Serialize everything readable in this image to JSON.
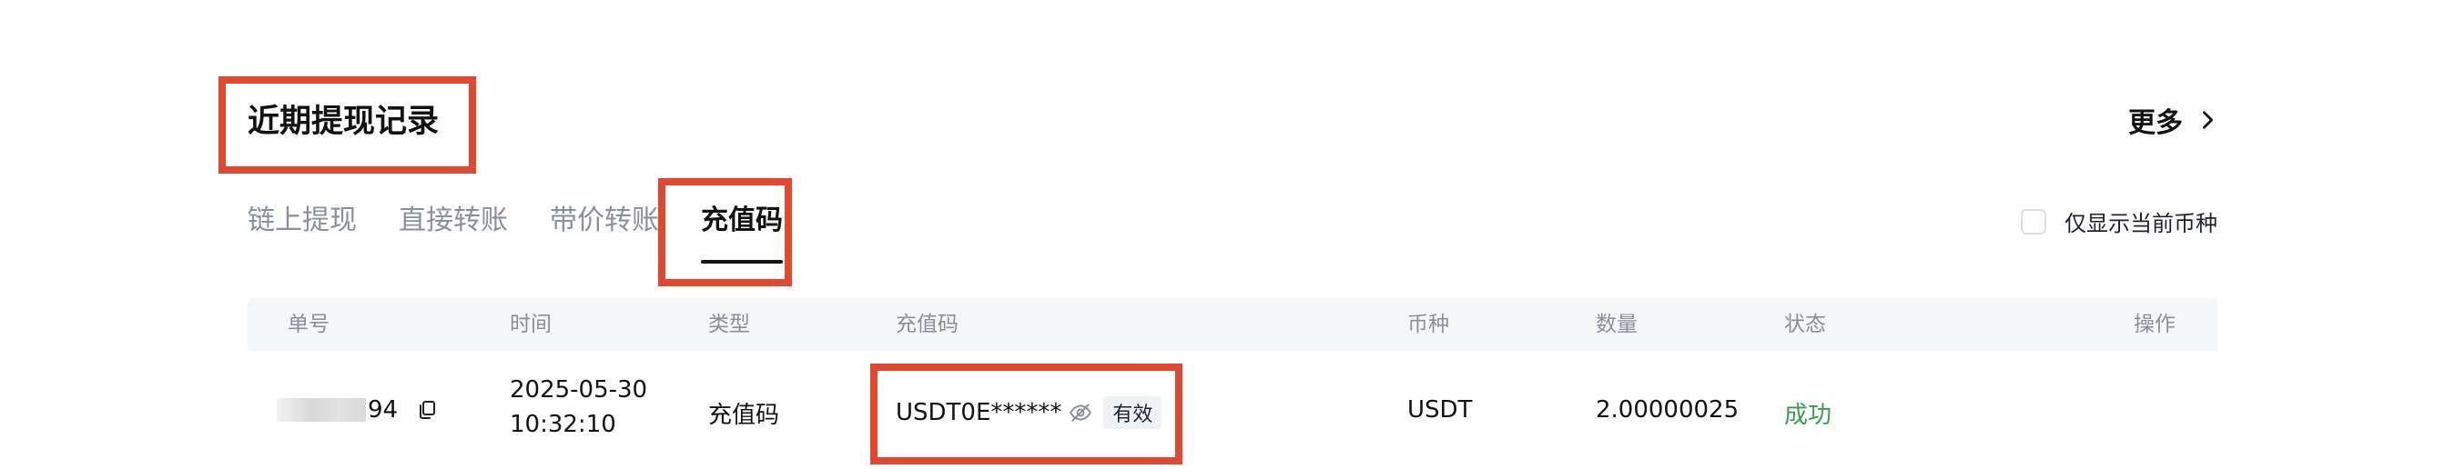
{
  "header": {
    "title": "近期提现记录",
    "more_label": "更多"
  },
  "tabs": [
    {
      "label": "链上提现",
      "active": false
    },
    {
      "label": "直接转账",
      "active": false
    },
    {
      "label": "带价转账",
      "active": false
    },
    {
      "label": "充值码",
      "active": true
    }
  ],
  "filter": {
    "only_current_label": "仅显示当前币种",
    "checked": false
  },
  "table": {
    "columns": [
      "单号",
      "时间",
      "类型",
      "充值码",
      "币种",
      "数量",
      "状态",
      "操作"
    ],
    "rows": [
      {
        "order_suffix": "94",
        "date": "2025-05-30",
        "time": "10:32:10",
        "type": "充值码",
        "code": "USDT0E******",
        "code_badge": "有效",
        "coin": "USDT",
        "amount": "2.00000025",
        "status": "成功",
        "action": ""
      }
    ]
  },
  "colors": {
    "success": "#3d9a55",
    "highlight": "#e2472f",
    "active_text": "#121212",
    "muted_text": "#8a8f98"
  },
  "icons": [
    "chevron-right-icon",
    "copy-icon",
    "eye-off-icon"
  ]
}
